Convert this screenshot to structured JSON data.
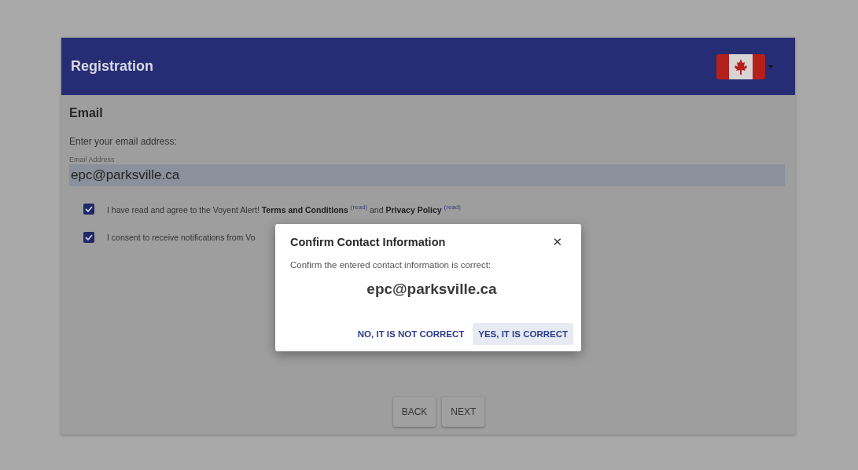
{
  "header": {
    "title": "Registration"
  },
  "section": {
    "title": "Email",
    "prompt": "Enter your email address:"
  },
  "email_field": {
    "label": "Email Address",
    "value": "epc@parksville.ca"
  },
  "agreements": [
    {
      "text": "I have read and agree to the Voyent Alert! **Terms and Conditions** $^{(read)}$ and **Privacy Policy** $^{(read)}$",
      "checked": true
    },
    {
      "text": "I consent to receive notifications from Vo",
      "checked": true
    }
  ],
  "buttons": [
    "BACK",
    "NEXT"
  ],
  "dialog": {
    "title": "Confirm Contact Information",
    "close": "✕",
    "message": "Confirm the entered contact information is correct:",
    "contact": "epc@parksville.ca",
    "actions": [
      {
        "label": "NO, IT IS NOT CORRECT",
        "selected": false
      },
      {
        "label": "YES, IT IS CORRECT",
        "selected": true
      }
    ]
  }
}
